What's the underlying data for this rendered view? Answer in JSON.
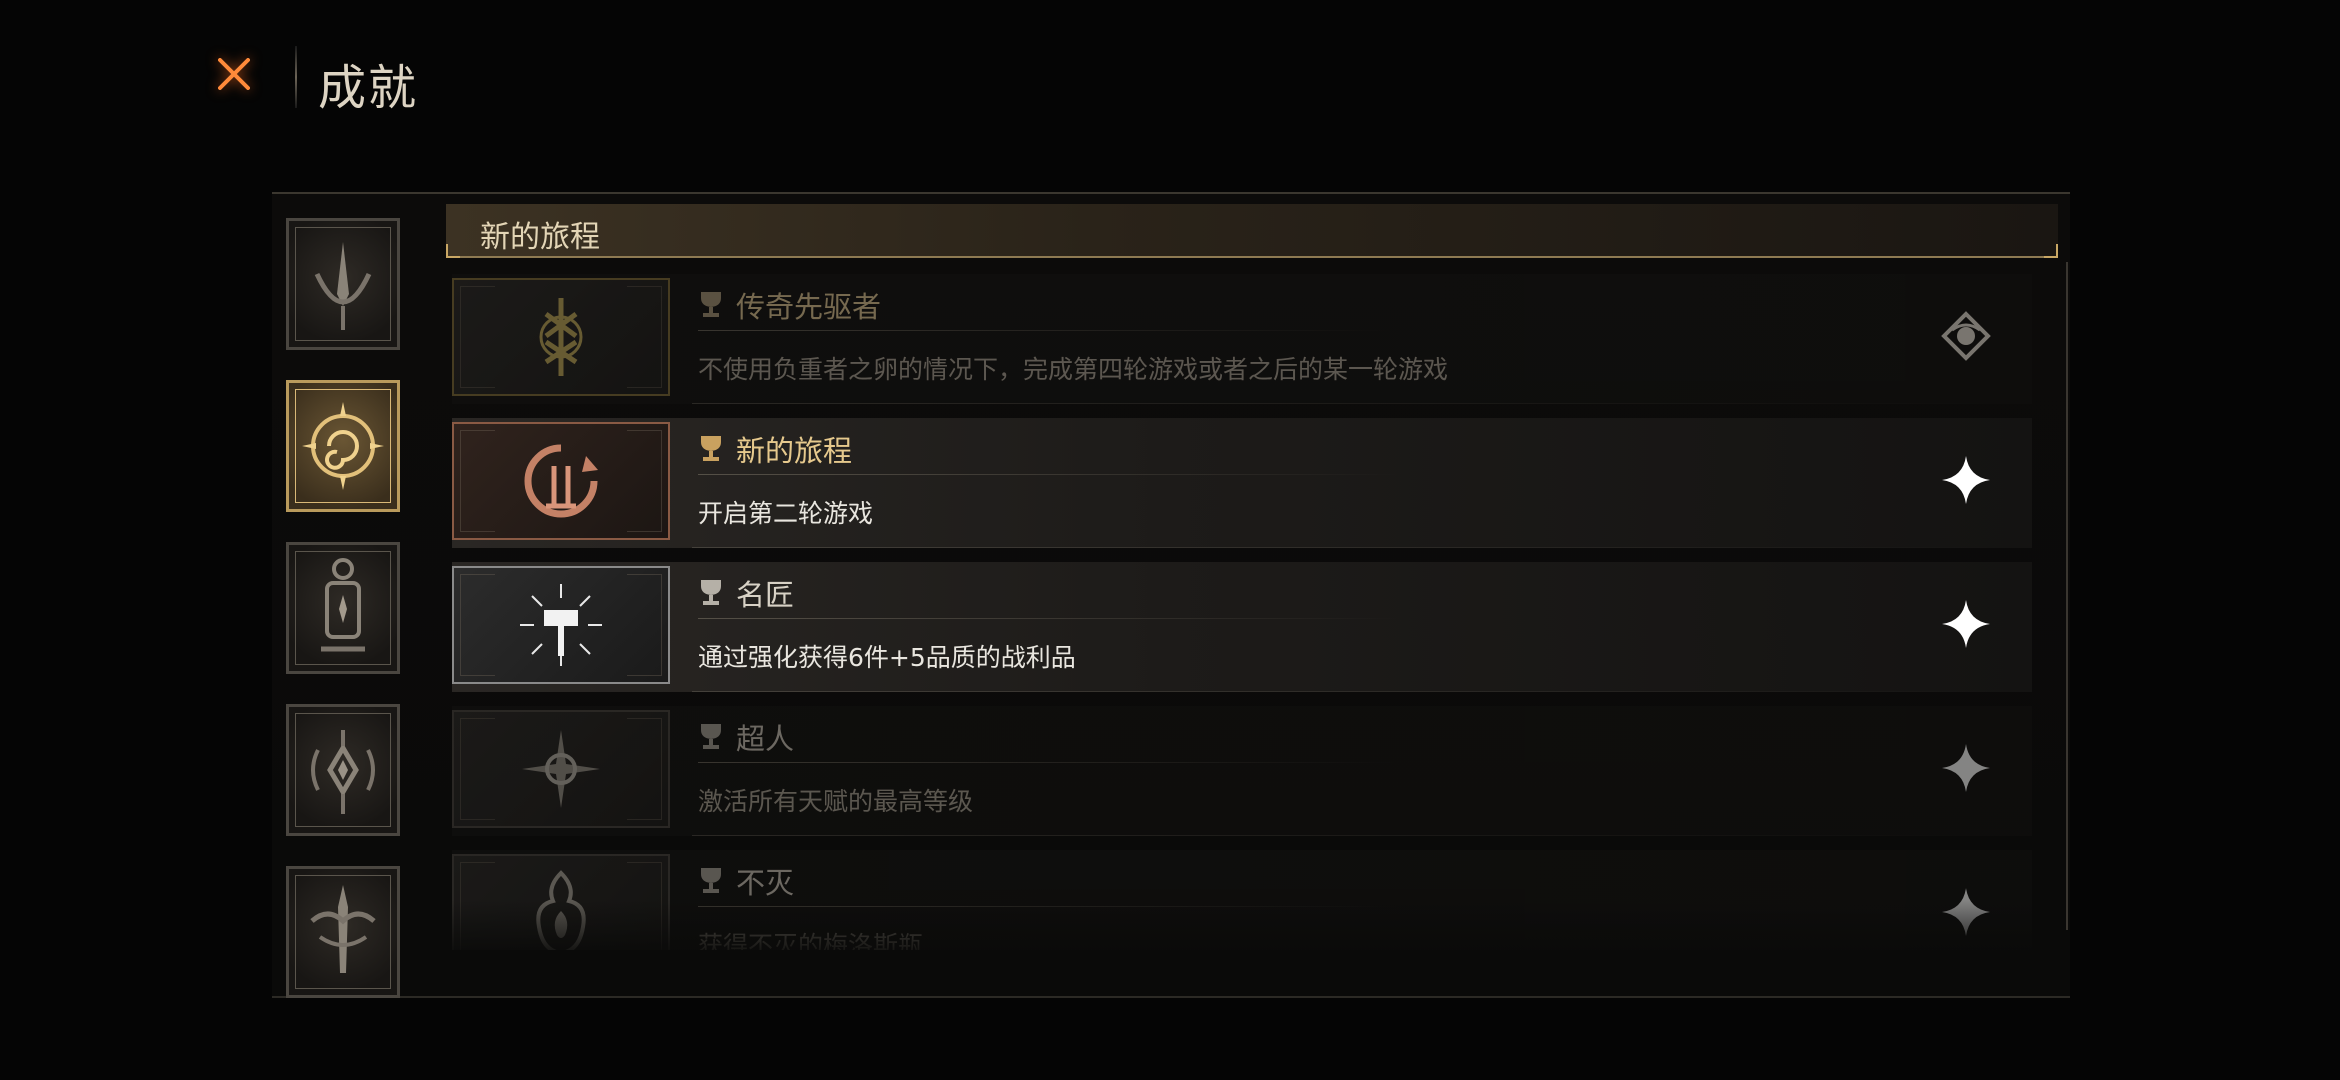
{
  "header": {
    "title": "成就",
    "close_icon": "close-x-icon",
    "accent": "#ff7a2a"
  },
  "sidebar": {
    "tabs": [
      {
        "icon": "spire-emblem-icon",
        "active": false
      },
      {
        "icon": "compass-spiral-emblem-icon",
        "active": true
      },
      {
        "icon": "lantern-emblem-icon",
        "active": false
      },
      {
        "icon": "thorned-eye-emblem-icon",
        "active": false
      },
      {
        "icon": "ornate-sword-emblem-icon",
        "active": false
      }
    ]
  },
  "section": {
    "title": "新的旅程"
  },
  "achievements": [
    {
      "name": "传奇先驱者",
      "desc": "不使用负重者之卵的情况下，完成第四轮游戏或者之后的某一轮游戏",
      "icon": "rune-sigil-icon",
      "status_icon": "crest-badge-icon",
      "style": "muted"
    },
    {
      "name": "新的旅程",
      "desc": "开启第二轮游戏",
      "icon": "cycle-rune-icon",
      "status_icon": "sparkle-star-icon",
      "style": "highlight"
    },
    {
      "name": "名匠",
      "desc": "通过强化获得6件+5品质的战利品",
      "icon": "radiant-hammer-icon",
      "status_icon": "sparkle-star-icon",
      "style": "highlight"
    },
    {
      "name": "超人",
      "desc": "激活所有天赋的最高等级",
      "icon": "star-compass-icon",
      "status_icon": "sparkle-star-icon",
      "style": "muted"
    },
    {
      "name": "不灭",
      "desc": "获得不灭的梅洛斯瓶",
      "icon": "flame-flask-icon",
      "status_icon": "sparkle-star-icon",
      "style": "muted"
    }
  ]
}
